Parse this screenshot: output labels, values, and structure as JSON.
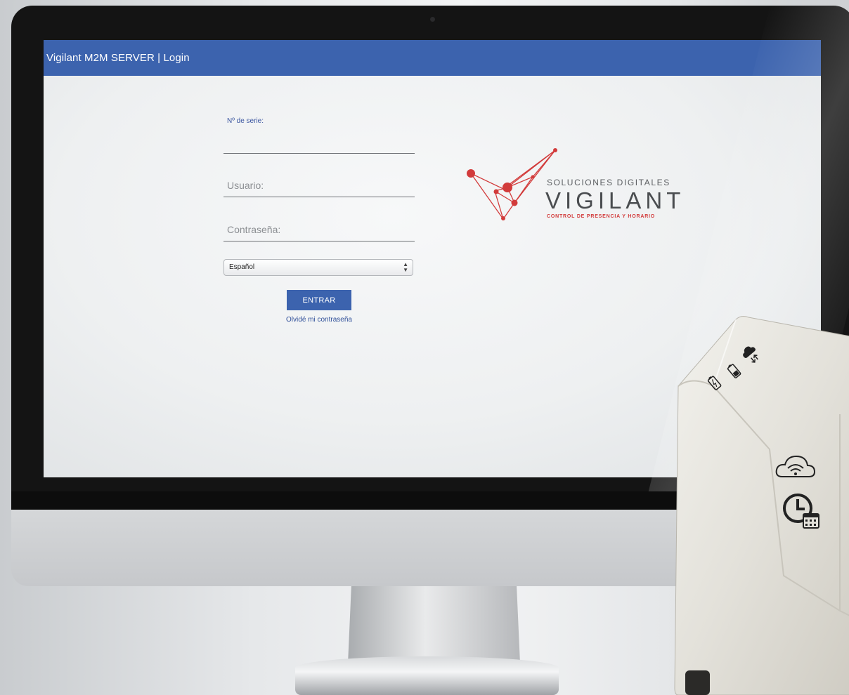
{
  "app": {
    "title": "Vigilant M2M SERVER | Login"
  },
  "form": {
    "serial_label": "Nº de serie:",
    "serial_value": "",
    "user_placeholder": "Usuario:",
    "user_value": "",
    "password_placeholder": "Contraseña:",
    "password_value": "",
    "language_selected": "Español",
    "submit_label": "ENTRAR",
    "forgot_label": "Olvidé mi contraseña"
  },
  "brand": {
    "tagline": "SOLUCIONES DIGITALES",
    "name": "VIGILANT",
    "subtitle": "CONTROL DE PRESENCIA Y HORARIO"
  },
  "colors": {
    "header": "#3c63ae",
    "button": "#3c63ae",
    "logo_red": "#d23b3b",
    "logo_gray": "#4a4d50"
  },
  "icons": {
    "device": [
      "battery-charging-icon",
      "battery-icon",
      "cloud-sync-icon",
      "cloud-wifi-icon",
      "clock-calendar-icon"
    ]
  }
}
